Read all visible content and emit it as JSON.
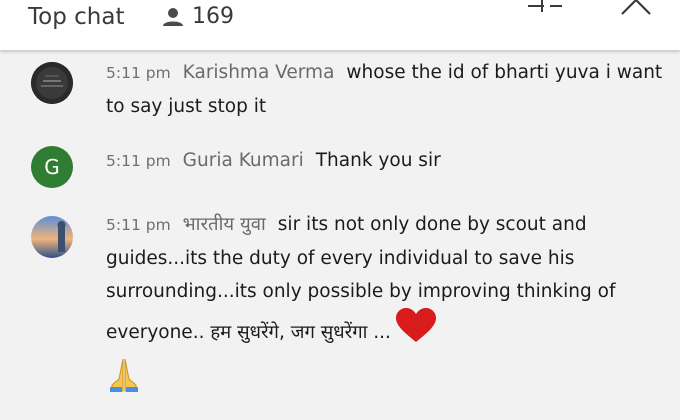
{
  "header": {
    "title": "Top chat",
    "viewer_count": "169",
    "viewer_icon": "person-icon",
    "filter_icon": "filter-icon",
    "close_icon": "close-icon",
    "background": "#ffffff"
  },
  "messages": [
    {
      "time": "5:11 pm",
      "author": "Karishma Verma",
      "text": "whose the id of bharti yuva i want to say just stop it",
      "avatar": "photo-avatar"
    },
    {
      "time": "5:11 pm",
      "author": "Guria Kumari",
      "text": "Thank you sir",
      "avatar_letter": "G",
      "avatar_color": "#2e7d32"
    },
    {
      "time": "5:11 pm",
      "author": "भारतीय युवा",
      "text": "sir its not only done by scout and guides...its the duty of every individual to save his surrounding...its only possible by improving thinking of everyone.. हम सुधरेंगे, जग सुधरेंगा ...",
      "avatar": "photo-avatar",
      "emoji": [
        "heart-emoji",
        "folded-hands-emoji"
      ]
    }
  ],
  "colors": {
    "chat_background": "#f2f2f2",
    "timestamp": "#707070",
    "author": "#6a6a6a",
    "heart": "#d81b1b"
  }
}
